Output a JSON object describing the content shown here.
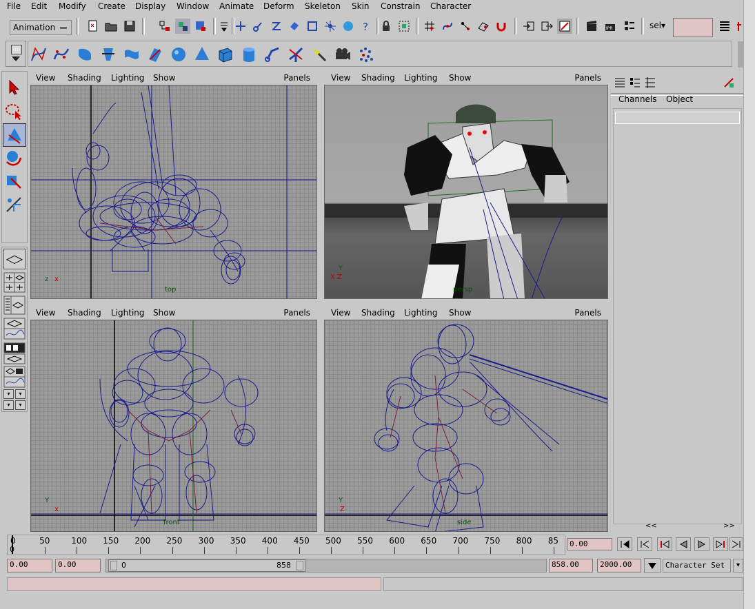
{
  "menubar": [
    "File",
    "Edit",
    "Modify",
    "Create",
    "Display",
    "Window",
    "Animate",
    "Deform",
    "Skeleton",
    "Skin",
    "Constrain",
    "Character"
  ],
  "module_menu": "Animation",
  "selection_mode": "sel",
  "viewport_menu": {
    "view": "View",
    "shading": "Shading",
    "lighting": "Lighting",
    "show": "Show",
    "panels": "Panels"
  },
  "viewports": {
    "top_left": {
      "camera": "top",
      "axis_v": "z",
      "axis_h": "x"
    },
    "top_right": {
      "camera": "persp",
      "axis_v": "Y",
      "axis_h": "X Z"
    },
    "bottom_left": {
      "camera": "front",
      "axis_v": "Y",
      "axis_h": "x"
    },
    "bottom_right": {
      "camera": "side",
      "axis_v": "Y",
      "axis_h": "Z"
    }
  },
  "channel_box": {
    "tab_channels": "Channels",
    "tab_object": "Object",
    "scroll_left": "<<",
    "scroll_right": ">>"
  },
  "time_slider": {
    "ticks": [
      "0",
      "50",
      "100",
      "150",
      "200",
      "250",
      "300",
      "350",
      "400",
      "450",
      "500",
      "550",
      "600",
      "650",
      "700",
      "750",
      "800",
      "85"
    ],
    "current_frame_marker": "0",
    "current_time": "0.00"
  },
  "range_slider": {
    "start_time": "0.00",
    "playback_start": "0.00",
    "range_start_label": "0",
    "range_end_label": "858",
    "playback_end": "858.00",
    "end_time": "2000.00",
    "character_set": "Character Set"
  },
  "colors": {
    "field_pink": "#e1c4c4",
    "wire_blue": "#1a1a8c",
    "ui_gray": "#c8c8c8"
  }
}
